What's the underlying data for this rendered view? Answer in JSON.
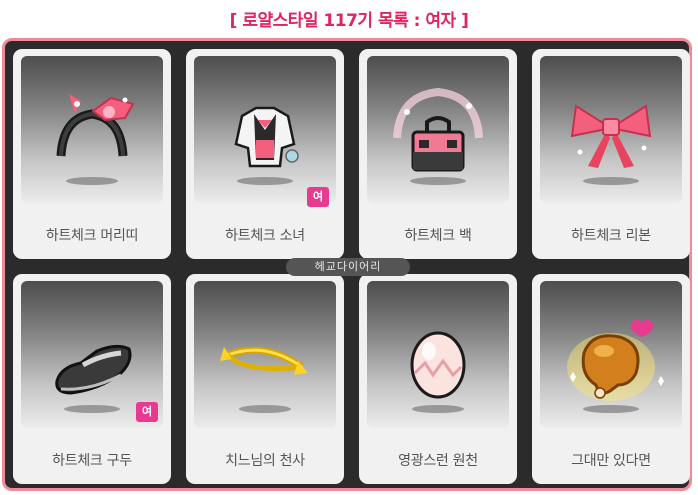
{
  "page": {
    "title": "[ 로얄스타일 117기 목록 : 여자 ]",
    "watermark": "헤교다이어리"
  },
  "items": [
    {
      "name": "하트체크 머리띠",
      "icon": "headband-icon",
      "badge": ""
    },
    {
      "name": "하트체크 소녀",
      "icon": "outfit-icon",
      "badge": "여"
    },
    {
      "name": "하트체크 백",
      "icon": "bag-icon",
      "badge": ""
    },
    {
      "name": "하트체크 리본",
      "icon": "ribbon-icon",
      "badge": ""
    },
    {
      "name": "하트체크 구두",
      "icon": "shoe-icon",
      "badge": "여"
    },
    {
      "name": "치느님의 천사",
      "icon": "halo-icon",
      "badge": ""
    },
    {
      "name": "영광스런 원천",
      "icon": "egg-icon",
      "badge": ""
    },
    {
      "name": "그대만 있다면",
      "icon": "chicken-leg-icon",
      "badge": ""
    }
  ],
  "colors": {
    "title": "#e0245e",
    "frame_border": "#f08a9b",
    "badge": "#e83a8f"
  }
}
